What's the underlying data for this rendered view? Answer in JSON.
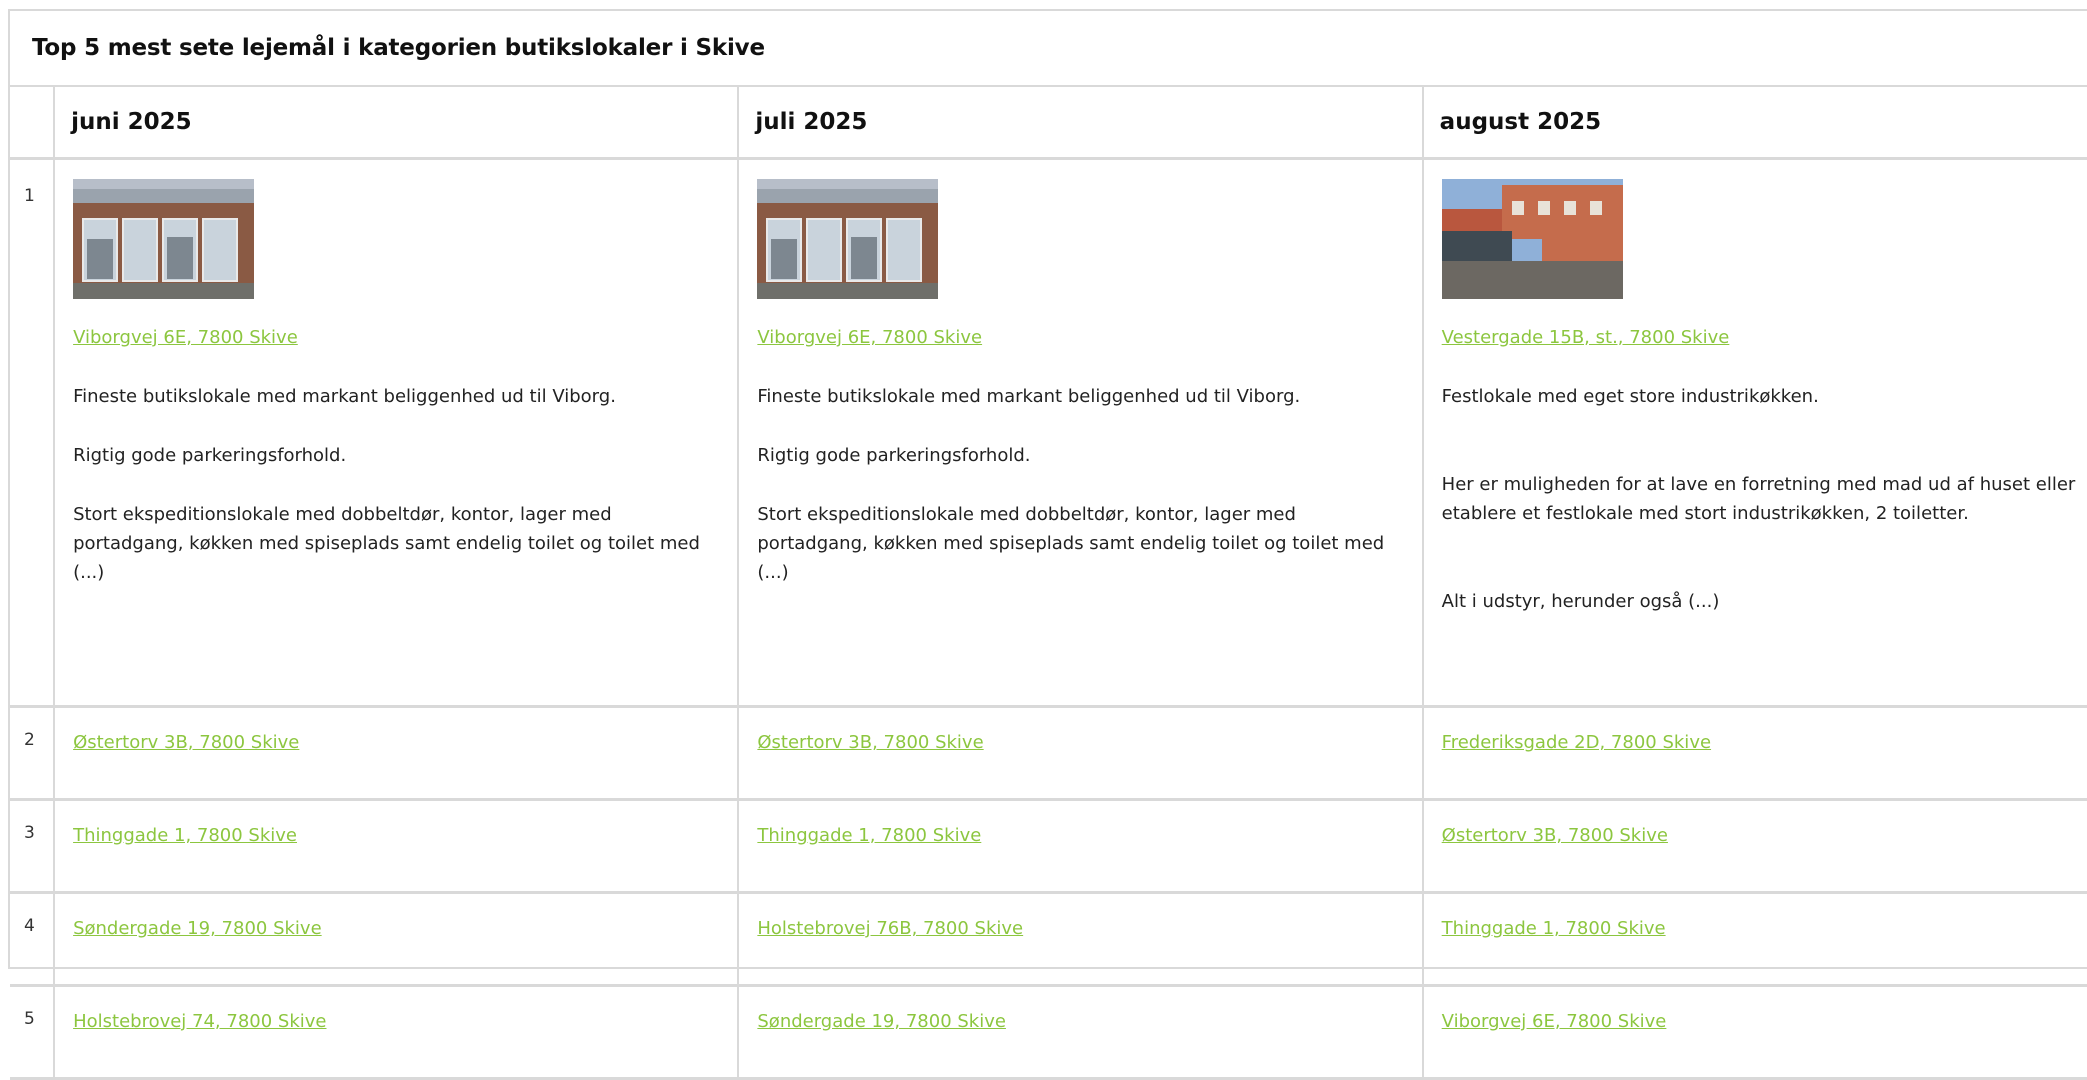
{
  "title": "Top 5 mest sete lejemål i kategorien butikslokaler i Skive",
  "months": [
    "juni 2025",
    "juli 2025",
    "august 2025"
  ],
  "colors": {
    "link": "#8cc63f",
    "border": "#d9d9d9"
  },
  "rows": [
    {
      "rank": "1",
      "cells": [
        {
          "address": "Viborgvej 6E, 7800 Skive",
          "image": "storefront-photo",
          "paragraphs": [
            "Fineste butikslokale med markant beliggenhed ud til Viborg.",
            "Rigtig gode parkeringsforhold.",
            "Stort ekspeditionslokale med dobbeltdør, kontor, lager med portadgang, køkken med spiseplads samt endelig toilet og toilet med (...)"
          ]
        },
        {
          "address": "Viborgvej 6E, 7800 Skive",
          "image": "storefront-photo",
          "paragraphs": [
            "Fineste butikslokale med markant beliggenhed ud til Viborg.",
            "Rigtig gode parkeringsforhold.",
            "Stort ekspeditionslokale med dobbeltdør, kontor, lager med portadgang, køkken med spiseplads samt endelig toilet og toilet med (...)"
          ]
        },
        {
          "address": "Vestergade 15B, st., 7800 Skive",
          "image": "courtyard-photo",
          "paragraphs": [
            "Festlokale med eget store industrikøkken.",
            "Her er muligheden for at lave en forretning med mad ud af huset eller etablere et festlokale med stort industrikøkken, 2 toiletter.",
            "Alt i udstyr, herunder også (...)"
          ]
        }
      ]
    },
    {
      "rank": "2",
      "cells": [
        "Østertorv 3B, 7800 Skive",
        "Østertorv 3B, 7800 Skive",
        "Frederiksgade 2D, 7800 Skive"
      ]
    },
    {
      "rank": "3",
      "cells": [
        "Thinggade 1, 7800 Skive",
        "Thinggade 1, 7800 Skive",
        "Østertorv 3B, 7800 Skive"
      ]
    },
    {
      "rank": "4",
      "cells": [
        "Søndergade 19, 7800 Skive",
        "Holstebrovej 76B, 7800 Skive",
        "Thinggade 1, 7800 Skive"
      ]
    },
    {
      "rank": "5",
      "cells": [
        "Holstebrovej 74, 7800 Skive",
        "Søndergade 19, 7800 Skive",
        "Viborgvej 6E, 7800 Skive"
      ]
    }
  ]
}
